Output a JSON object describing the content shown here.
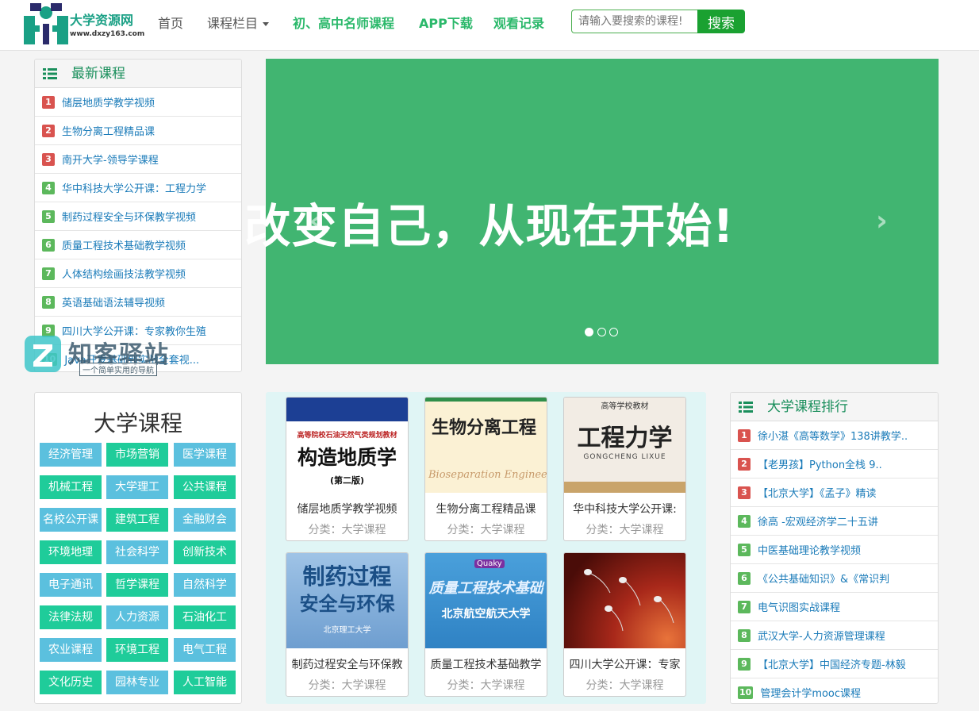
{
  "header": {
    "logo_text": "大学资源网",
    "logo_url": "www.dxzy163.com",
    "nav": [
      "首页",
      "课程栏目",
      "初、高中名师课程",
      "APP下载",
      "观看记录"
    ],
    "search_placeholder": "请输入要搜索的课程!",
    "search_button": "搜索"
  },
  "latest": {
    "title": "最新课程",
    "items": [
      {
        "num": "1",
        "label": "储层地质学教学视频"
      },
      {
        "num": "2",
        "label": "生物分离工程精品课"
      },
      {
        "num": "3",
        "label": "南开大学-领导学课程"
      },
      {
        "num": "4",
        "label": "华中科技大学公开课：工程力学"
      },
      {
        "num": "5",
        "label": "制药过程安全与环保教学视频"
      },
      {
        "num": "6",
        "label": "质量工程技术基础教学视频"
      },
      {
        "num": "7",
        "label": "人体结构绘画技法教学视频"
      },
      {
        "num": "8",
        "label": "英语基础语法辅导视频"
      },
      {
        "num": "9",
        "label": "四川大学公开课：专家教你生殖"
      },
      {
        "num": "10",
        "label": "Java开发基础到实战全套视..."
      }
    ]
  },
  "banner": {
    "text": "改变自己，从现在开始!",
    "prev": "‹",
    "next": "›"
  },
  "watermark": {
    "title": "知客驿站",
    "subtitle": "一个简单实用的导航"
  },
  "university": {
    "title": "大学课程",
    "tags": [
      "经济管理",
      "市场营销",
      "医学课程",
      "机械工程",
      "大学理工",
      "公共课程",
      "名校公开课",
      "建筑工程",
      "金融财会",
      "环境地理",
      "社会科学",
      "创新技术",
      "电子通讯",
      "哲学课程",
      "自然科学",
      "法律法规",
      "人力资源",
      "石油化工",
      "农业课程",
      "环境工程",
      "电气工程",
      "文化历史",
      "园林专业",
      "人工智能"
    ]
  },
  "cards": [
    {
      "title": "储层地质学教学视频",
      "category": "分类：大学课程",
      "cover_top": "高等院校石油天然气类规划教材",
      "cover_main": "构造地质学",
      "cover_sub": "(第二版)"
    },
    {
      "title": "生物分离工程精品课",
      "category": "分类：大学课程",
      "cover_main": "生物分离工程",
      "cover_sub": "Bioseparation Engineering"
    },
    {
      "title": "华中科技大学公开课:",
      "category": "分类：大学课程",
      "cover_top": "高等学校教材",
      "cover_main": "工程力学",
      "cover_sub": "GONGCHENG LIXUE"
    },
    {
      "title": "制药过程安全与环保教",
      "category": "分类：大学课程",
      "cover_main": "制药过程",
      "cover_main2": "安全与环保",
      "cover_sub": "北京理工大学"
    },
    {
      "title": "质量工程技术基础教学",
      "category": "分类：大学课程",
      "cover_top": "Quaky",
      "cover_main": "质量工程技术基础",
      "cover_sub": "北京航空航天大学"
    },
    {
      "title": "四川大学公开课：专家",
      "category": "分类：大学课程"
    }
  ],
  "ranking": {
    "title": "大学课程排行",
    "items": [
      {
        "num": "1",
        "label": "徐小湛《高等数学》138讲教学.."
      },
      {
        "num": "2",
        "label": "【老男孩】Python全栈 9.."
      },
      {
        "num": "3",
        "label": "【北京大学】《孟子》精读"
      },
      {
        "num": "4",
        "label": "徐高 -宏观经济学二十五讲"
      },
      {
        "num": "5",
        "label": "中医基础理论教学视频"
      },
      {
        "num": "6",
        "label": "《公共基础知识》&《常识判"
      },
      {
        "num": "7",
        "label": "电气识图实战课程"
      },
      {
        "num": "8",
        "label": "武汉大学-人力资源管理课程"
      },
      {
        "num": "9",
        "label": "【北京大学】中国经济专题-林毅"
      },
      {
        "num": "10",
        "label": "管理会计学mooc课程"
      }
    ]
  }
}
